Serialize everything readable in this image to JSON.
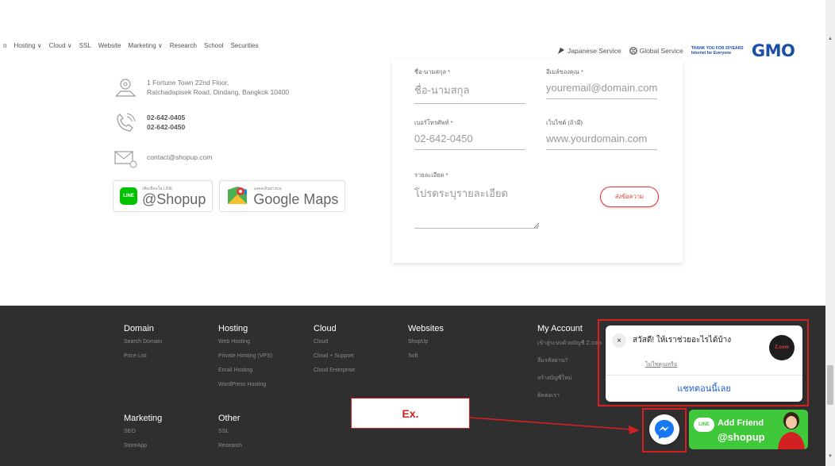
{
  "nav": {
    "left_items": [
      "n",
      "Hosting ∨",
      "Cloud ∨",
      "SSL",
      "Website",
      "Marketing ∨",
      "Research",
      "School",
      "Securities"
    ],
    "japanese_service": "Japanese Service",
    "global_service": "Global Service",
    "gmo_tag_line1": "THANK YOU FOR 20YEARS",
    "gmo_tag_line2": "Internet for Everyone",
    "gmo_logo": "GMO"
  },
  "contact": {
    "address_line1": "1 Fortune Town 22nd Floor,",
    "address_line2": "Ratchadapisek Road, Dindang, Bangkok 10400",
    "phone1": "02-642-0405",
    "phone2": "02-642-0450",
    "email": "contact@shopup.com",
    "line_small": "เพิ่มเพื่อนใน LINE",
    "line_handle": "@Shopup",
    "maps_small": "แสดงเส้นทางบน",
    "maps_google": "Google",
    "maps_word": "Maps"
  },
  "form": {
    "name_label": "ชื่อ-นามสกุล *",
    "name_placeholder": "ชื่อ-นามสกุล",
    "email_label": "อีเมล์ของคุณ *",
    "email_placeholder": "youremail@domain.com",
    "phone_label": "เบอร์โทรศัพท์ *",
    "phone_placeholder": "02-642-0450",
    "website_label": "เว็บไซต์ (ถ้ามี)",
    "website_placeholder": "www.yourdomain.com",
    "detail_label": "รายละเอียด *",
    "detail_placeholder": "โปรดระบุรายละเอียด",
    "send_label": "ส่งข้อความ"
  },
  "footer": {
    "domain": {
      "title": "Domain",
      "links": [
        "Search Domain",
        "Price List"
      ]
    },
    "hosting": {
      "title": "Hosting",
      "links": [
        "Web Hosting",
        "Private Hosting (VPS)",
        "Email Hosting",
        "WordPress Hosting"
      ]
    },
    "cloud": {
      "title": "Cloud",
      "links": [
        "Cloud",
        "Cloud + Support",
        "Cloud Enterprise"
      ]
    },
    "websites": {
      "title": "Websites",
      "links": [
        "ShopUp",
        "Soft"
      ]
    },
    "account": {
      "title": "My Account",
      "links": [
        "เข้าสู่ระบบด้วยบัญชี Z.com",
        "ลืมรหัสผ่าน?",
        "สร้างบัญชีใหม่",
        "ติดต่อเรา"
      ]
    },
    "marketing": {
      "title": "Marketing",
      "links": [
        "SEO",
        "StoreApp"
      ]
    },
    "other": {
      "title": "Other",
      "links": [
        "SSL",
        "Research"
      ]
    }
  },
  "chat_popup": {
    "close_symbol": "×",
    "greeting": "สวัสดี! ให้เราช่วยอะไรได้บ้าง",
    "subtext": "ไม่ใช่คุณหรือ",
    "avatar_text": "Z.com",
    "chat_now": "แชทตอนนี้เลย"
  },
  "annotation": {
    "ex_label": "Ex."
  },
  "add_friend": {
    "line_badge": "LINE",
    "title": "Add Friend",
    "handle": "@shopup"
  },
  "colors": {
    "accent_red": "#d32020",
    "gmo_blue": "#1b4fa8",
    "line_green": "#3fc83a",
    "footer_bg": "#2f2f2f",
    "messenger_blue": "#1877f2"
  }
}
